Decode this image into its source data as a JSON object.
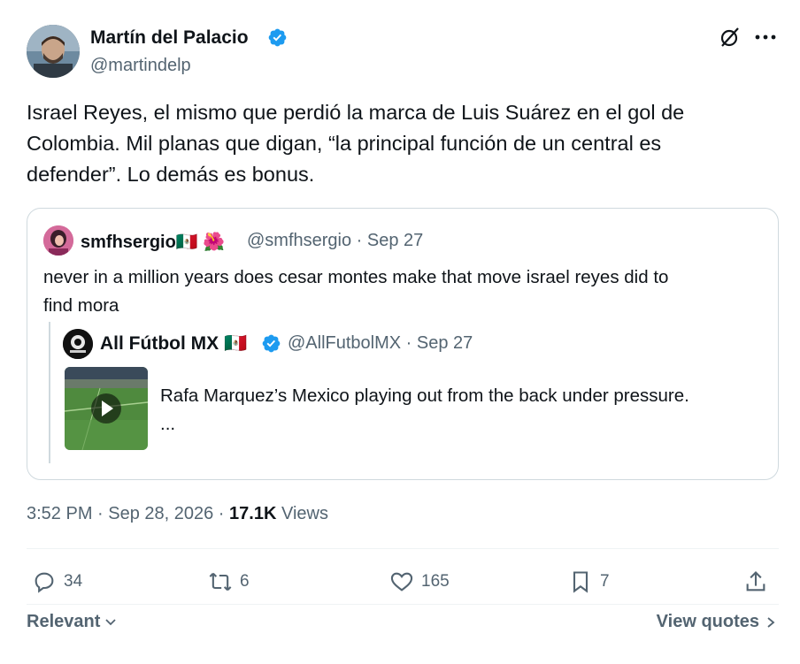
{
  "author": {
    "name": "Martín del Palacio",
    "handle": "@martindelp"
  },
  "tweet": {
    "text_line1": "Israel Reyes, el mismo que perdió la marca de Luis Suárez en el gol de",
    "text_line2": "Colombia. Mil planas que digan, “la principal función de un central es",
    "text_line3": "defender”. Lo demás es bonus."
  },
  "quote": {
    "name": "smfhsergio",
    "emoji_flag": "🇲🇽",
    "emoji_flower": "🌺",
    "meta": "@smfhsergio · Sep 27",
    "text_line1": "never in a million years does cesar montes make that move israel reyes did to",
    "text_line2": "find mora",
    "nested": {
      "name": "All Fútbol MX",
      "emoji_flag": "🇲🇽",
      "meta": "@AllFutbolMX · Sep 27",
      "text_line1": "Rafa Marquez’s Mexico playing out from the back under pressure.",
      "text_line2": "..."
    }
  },
  "meta": {
    "time": "3:52 PM · Sep 28, 2026 · ",
    "views_count": "17.1K",
    "views_label": " Views"
  },
  "actions": {
    "replies": "34",
    "reposts": "6",
    "likes": "165",
    "bookmarks": "7"
  },
  "footer": {
    "sort_label": "Relevant",
    "view_quotes": "View quotes"
  },
  "colors": {
    "verified": "#1d9bf0",
    "secondary_text": "#536471",
    "border": "#cfd9de"
  }
}
